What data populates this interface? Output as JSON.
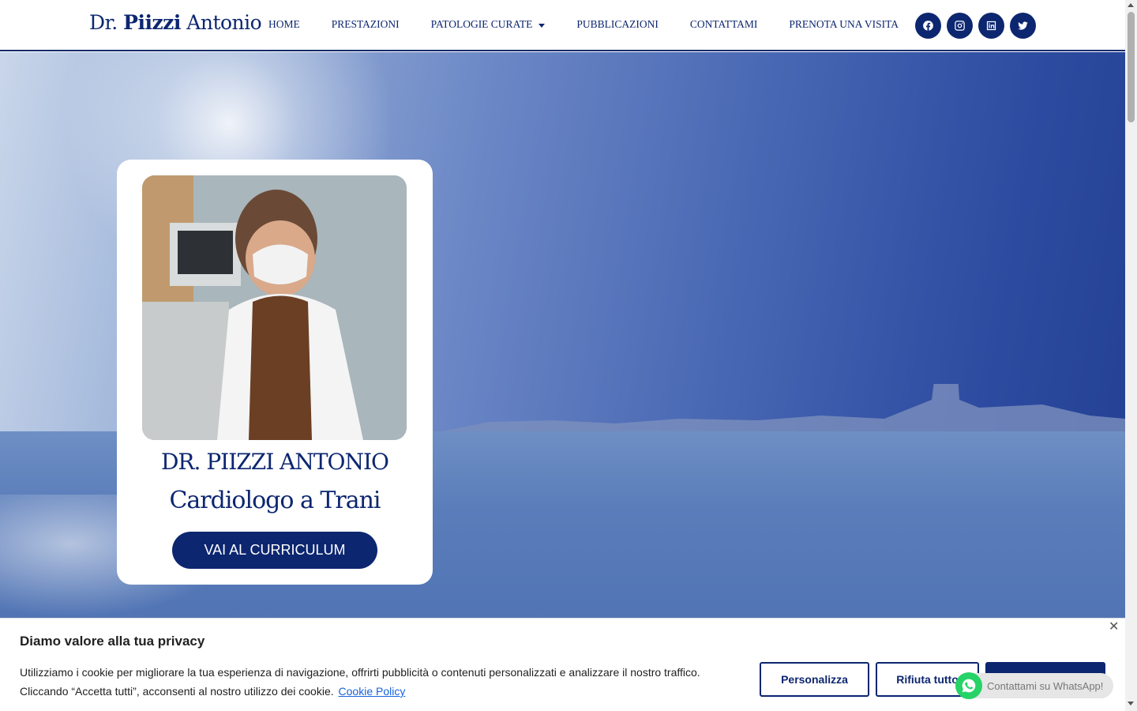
{
  "header": {
    "logo": {
      "prefix": "Dr.",
      "bold": "Piizzi",
      "suffix": "Antonio"
    },
    "nav": [
      {
        "label": "HOME"
      },
      {
        "label": "PRESTAZIONI"
      },
      {
        "label": "PATOLOGIE CURATE",
        "has_dropdown": true
      },
      {
        "label": "PUBBLICAZIONI"
      },
      {
        "label": "CONTATTAMI"
      },
      {
        "label": "PRENOTA UNA VISITA"
      }
    ],
    "socials": [
      "facebook-icon",
      "instagram-icon",
      "linkedin-icon",
      "twitter-icon"
    ]
  },
  "hero": {
    "name": "DR. PIIZZI ANTONIO",
    "subtitle": "Cardiologo a Trani",
    "cta": "VAI AL CURRICULUM"
  },
  "cookie": {
    "title": "Diamo valore alla tua privacy",
    "text": "Utilizziamo i cookie per migliorare la tua esperienza di navigazione, offrirti pubblicità o contenuti personalizzati e analizzare il nostro traffico. Cliccando “Accetta tutti”, acconsenti al nostro utilizzo dei cookie.",
    "policy_link": "Cookie Policy",
    "btn_customize": "Personalizza",
    "btn_reject": "Rifiuta tutto",
    "btn_accept": ""
  },
  "whatsapp": {
    "label": "Contattami su WhatsApp!"
  },
  "colors": {
    "brand": "#0c2670",
    "link": "#1863dc",
    "whatsapp": "#25d366"
  }
}
